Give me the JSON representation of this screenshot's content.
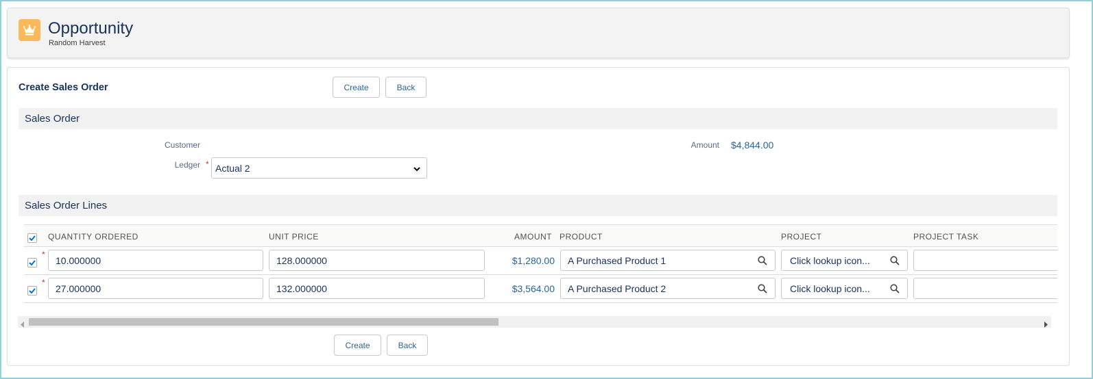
{
  "header": {
    "title": "Opportunity",
    "subtitle": "Random Harvest",
    "icon": "crown-icon",
    "icon_color": "#fcb95b"
  },
  "form": {
    "title": "Create Sales Order",
    "create_label": "Create",
    "back_label": "Back"
  },
  "sales_order": {
    "section_label": "Sales Order",
    "customer_label": "Customer",
    "ledger_label": "Ledger",
    "ledger_required": "*",
    "ledger_value": "Actual 2",
    "amount_label": "Amount",
    "amount_value": "$4,844.00"
  },
  "lines": {
    "section_label": "Sales Order Lines",
    "columns": [
      "QUANTITY ORDERED",
      "UNIT PRICE",
      "AMOUNT",
      "PRODUCT",
      "PROJECT",
      "PROJECT TASK"
    ],
    "rows": [
      {
        "required": "*",
        "quantity": "10.000000",
        "unit_price": "128.000000",
        "amount": "$1,280.00",
        "product": "A Purchased Product 1",
        "project_placeholder": "Click lookup icon...",
        "project_task": ""
      },
      {
        "required": "*",
        "quantity": "27.000000",
        "unit_price": "132.000000",
        "amount": "$3,564.00",
        "product": "A Purchased Product 2",
        "project_placeholder": "Click lookup icon...",
        "project_task": ""
      }
    ]
  },
  "colors": {
    "accent": "#0070d2",
    "heading": "#16325c",
    "required": "#c23934"
  }
}
